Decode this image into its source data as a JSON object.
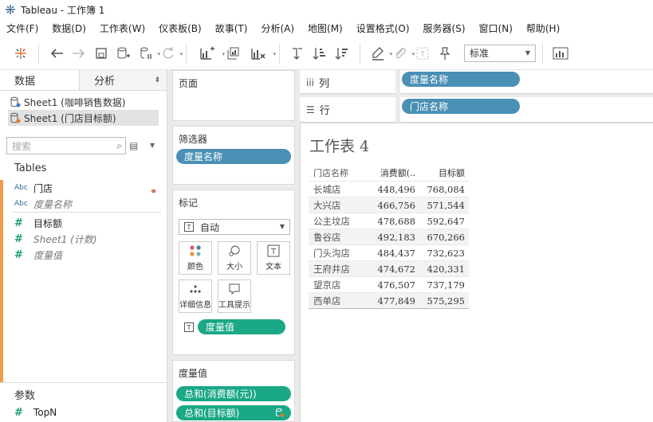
{
  "window": {
    "title": "Tableau - 工作簿 1"
  },
  "menu": [
    "文件(F)",
    "数据(D)",
    "工作表(W)",
    "仪表板(B)",
    "故事(T)",
    "分析(A)",
    "地图(M)",
    "设置格式(O)",
    "服务器(S)",
    "窗口(N)",
    "帮助(H)"
  ],
  "toolbar": {
    "fit_select": "标准"
  },
  "data_pane": {
    "tab_data": "数据",
    "tab_analysis": "分析",
    "sources": [
      "Sheet1 (咖啡销售数据)",
      "Sheet1 (门店目标额)"
    ],
    "search_placeholder": "搜索",
    "tables_header": "Tables",
    "dimensions": [
      {
        "type": "Abc",
        "name": "门店"
      },
      {
        "type": "Abc",
        "name": "度量名称"
      }
    ],
    "measures": [
      {
        "type": "#",
        "name": "目标额"
      },
      {
        "type": "#",
        "name": "Sheet1 (计数)"
      },
      {
        "type": "#",
        "name": "度量值"
      }
    ],
    "params_header": "参数",
    "params": [
      {
        "type": "#",
        "name": "TopN"
      }
    ]
  },
  "pages_card": {
    "title": "页面"
  },
  "filters_card": {
    "title": "筛选器",
    "pill": "度量名称"
  },
  "marks_card": {
    "title": "标记",
    "mark_type": "自动",
    "buttons": {
      "color": "颜色",
      "size": "大小",
      "label": "文本",
      "detail": "详细信息",
      "tooltip": "工具提示"
    },
    "text_box": "T",
    "pill": "度量值"
  },
  "measure_values_card": {
    "title": "度量值",
    "pills": [
      "总和(消费额(元))",
      "总和(目标额)"
    ]
  },
  "shelves": {
    "columns_label": "列",
    "columns_pill": "度量名称",
    "rows_label": "行",
    "rows_pill": "门店名称"
  },
  "worksheet": {
    "title": "工作表 4",
    "headers": [
      "门店名称",
      "消费额(..",
      "目标额"
    ],
    "rows": [
      [
        "长城店",
        "448,496",
        "768,084"
      ],
      [
        "大兴店",
        "466,756",
        "571,544"
      ],
      [
        "公主坟店",
        "478,688",
        "592,647"
      ],
      [
        "鲁谷店",
        "492,183",
        "670,266"
      ],
      [
        "门头沟店",
        "484,437",
        "732,623"
      ],
      [
        "王府井店",
        "474,672",
        "420,331"
      ],
      [
        "望京店",
        "476,507",
        "737,179"
      ],
      [
        "西单店",
        "477,849",
        "575,295"
      ]
    ]
  }
}
